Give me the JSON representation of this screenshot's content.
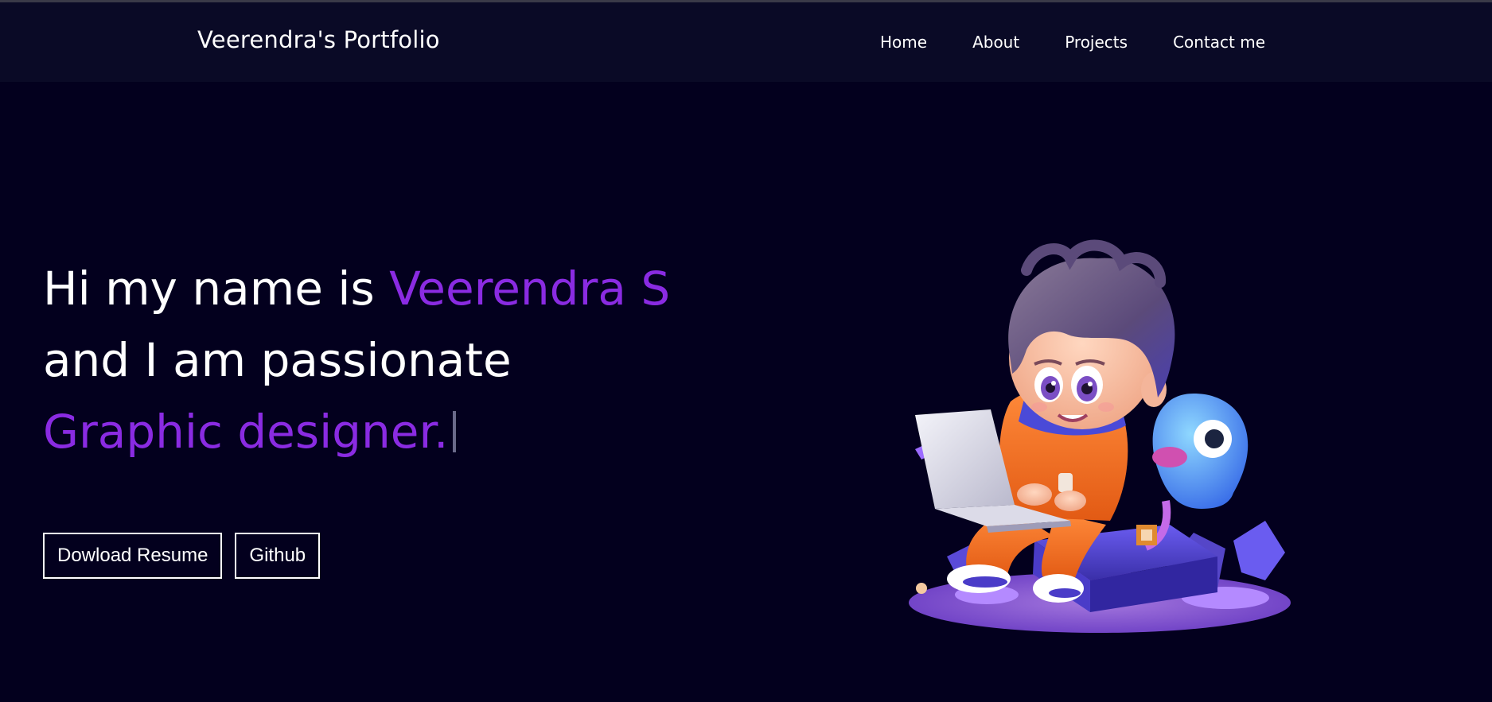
{
  "navbar": {
    "brand": "Veerendra's Portfolio",
    "links": [
      "Home",
      "About",
      "Projects",
      "Contact me"
    ]
  },
  "hero": {
    "line1_prefix": "Hi my name is ",
    "line1_name": "Veerendra S",
    "line2": "and I am passionate",
    "line3_role": "Graphic designer."
  },
  "buttons": {
    "resume": "Dowload Resume",
    "github": "Github"
  },
  "colors": {
    "background": "#03001e",
    "navbar": "#0a0a26",
    "accent": "#8a2be2",
    "text": "#ffffff"
  },
  "illustration": {
    "subject": "3d-cartoon-boy-with-laptop-and-blue-creature"
  }
}
